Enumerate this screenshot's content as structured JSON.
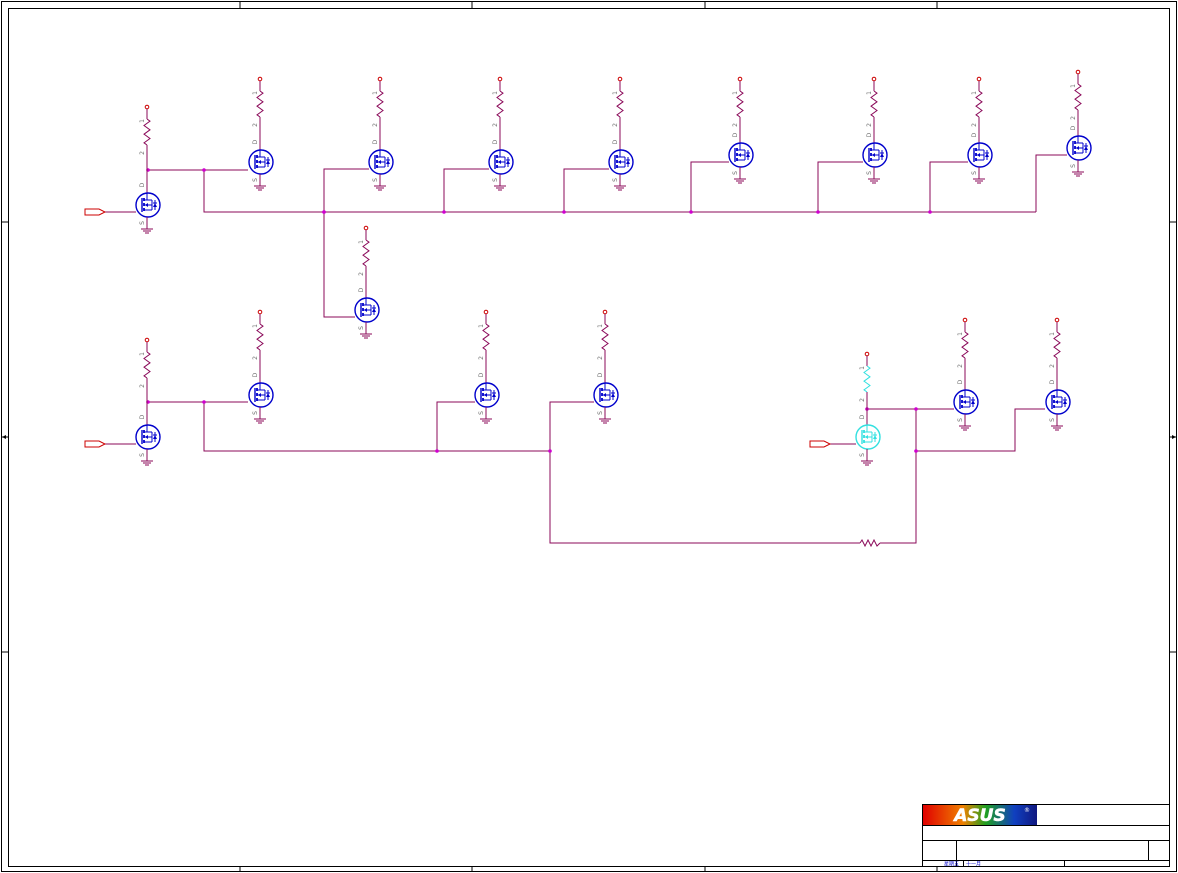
{
  "title_block": {
    "logo_text": "ASUS",
    "registered_mark": "®",
    "footer_left": "星期五",
    "footer_right": "十一月"
  },
  "colors": {
    "wire": "#8b0a5a",
    "mosfet": "#0000cc",
    "mosfet_highlight": "#33e0e0",
    "power_pin": "#cc0000",
    "port": "#cc0000",
    "frame": "#000000",
    "logo_left": "#d40000",
    "logo_right": "#1a2ea0"
  }
}
